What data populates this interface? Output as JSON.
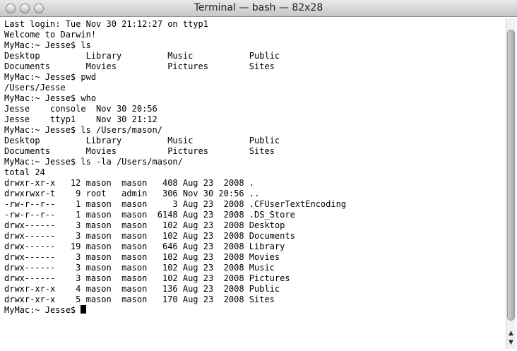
{
  "window": {
    "title": "Terminal — bash — 82x28"
  },
  "terminal": {
    "lines": [
      "Last login: Tue Nov 30 21:12:27 on ttyp1",
      "Welcome to Darwin!",
      "MyMac:~ Jesse$ ls",
      "Desktop         Library         Music           Public",
      "Documents       Movies          Pictures        Sites",
      "MyMac:~ Jesse$ pwd",
      "/Users/Jesse",
      "MyMac:~ Jesse$ who",
      "Jesse    console  Nov 30 20:56",
      "Jesse    ttyp1    Nov 30 21:12",
      "MyMac:~ Jesse$ ls /Users/mason/",
      "Desktop         Library         Music           Public",
      "Documents       Movies          Pictures        Sites",
      "MyMac:~ Jesse$ ls -la /Users/mason/",
      "total 24",
      "drwxr-xr-x   12 mason  mason   408 Aug 23  2008 .",
      "drwxrwxr-t    9 root   admin   306 Nov 30 20:56 ..",
      "-rw-r--r--    1 mason  mason     3 Aug 23  2008 .CFUserTextEncoding",
      "-rw-r--r--    1 mason  mason  6148 Aug 23  2008 .DS_Store",
      "drwx------    3 mason  mason   102 Aug 23  2008 Desktop",
      "drwx------    3 mason  mason   102 Aug 23  2008 Documents",
      "drwx------   19 mason  mason   646 Aug 23  2008 Library",
      "drwx------    3 mason  mason   102 Aug 23  2008 Movies",
      "drwx------    3 mason  mason   102 Aug 23  2008 Music",
      "drwx------    3 mason  mason   102 Aug 23  2008 Pictures",
      "drwxr-xr-x    4 mason  mason   136 Aug 23  2008 Public",
      "drwxr-xr-x    5 mason  mason   170 Aug 23  2008 Sites"
    ],
    "prompt": "MyMac:~ Jesse$ "
  },
  "scroll_icons": {
    "up": "triangle-up",
    "down": "triangle-down"
  }
}
